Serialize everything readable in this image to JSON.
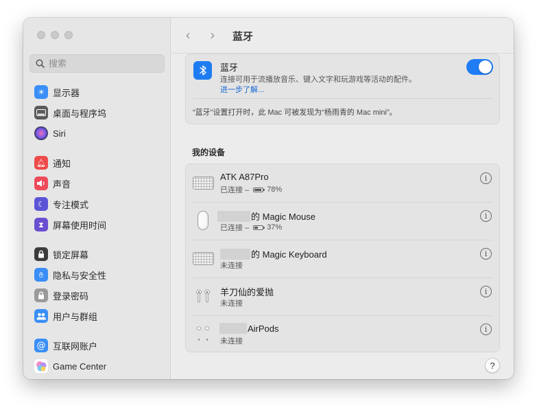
{
  "window": {
    "title": "蓝牙"
  },
  "search": {
    "placeholder": "搜索"
  },
  "sidebar": {
    "items": [
      {
        "label": "显示器",
        "icon": "display-icon",
        "color": "#3a8ef6"
      },
      {
        "label": "桌面与程序坞",
        "icon": "dock-icon",
        "color": "#5a5a5a"
      },
      {
        "label": "Siri",
        "icon": "siri-icon",
        "color": "#8a54e0"
      },
      {
        "label": "通知",
        "icon": "notification-bell-icon",
        "color": "#ef4a4a"
      },
      {
        "label": "声音",
        "icon": "speaker-icon",
        "color": "#ef4a5a"
      },
      {
        "label": "专注模式",
        "icon": "moon-icon",
        "color": "#5b55d6"
      },
      {
        "label": "屏幕使用时间",
        "icon": "hourglass-icon",
        "color": "#6a4fd1"
      },
      {
        "label": "锁定屏幕",
        "icon": "lock-screen-icon",
        "color": "#3c3c3c"
      },
      {
        "label": "隐私与安全性",
        "icon": "hand-icon",
        "color": "#3a8ef6"
      },
      {
        "label": "登录密码",
        "icon": "lock-icon",
        "color": "#9a9a9a"
      },
      {
        "label": "用户与群组",
        "icon": "users-icon",
        "color": "#3a8ef6"
      },
      {
        "label": "互联网账户",
        "icon": "at-icon",
        "color": "#3a8ef6"
      },
      {
        "label": "Game Center",
        "icon": "game-center-icon",
        "color": "#e9a3d0"
      }
    ]
  },
  "bluetooth": {
    "title": "蓝牙",
    "description": "连接可用于流播放音乐、键入文字和玩游戏等活动的配件。",
    "learn_more": "进一步了解...",
    "enabled": true,
    "footer": "“蓝牙”设置打开时，此 Mac 可被发现为“杨雨青的 Mac mini”。"
  },
  "devices": {
    "section_title": "我的设备",
    "items": [
      {
        "name": "ATK A87Pro",
        "status": "已连接 –",
        "battery": "78%",
        "battery_level": 0.78,
        "icon": "keyboard-icon",
        "redacted": false
      },
      {
        "name": "的 Magic Mouse",
        "status": "已连接 –",
        "battery": "37%",
        "battery_level": 0.37,
        "icon": "mouse-icon",
        "redacted": true
      },
      {
        "name": "的 Magic Keyboard",
        "status": "未连接",
        "icon": "keyboard-icon",
        "redacted": true
      },
      {
        "name": "羊刀仙的爱抛",
        "status": "未连接",
        "icon": "airpods-icon",
        "redacted": false
      },
      {
        "name": "AirPods",
        "status": "未连接",
        "icon": "airpods-icon",
        "redacted": true
      }
    ]
  },
  "help": {
    "label": "?"
  },
  "colors": {
    "accent": "#1f7cf5",
    "link": "#1667d6"
  }
}
